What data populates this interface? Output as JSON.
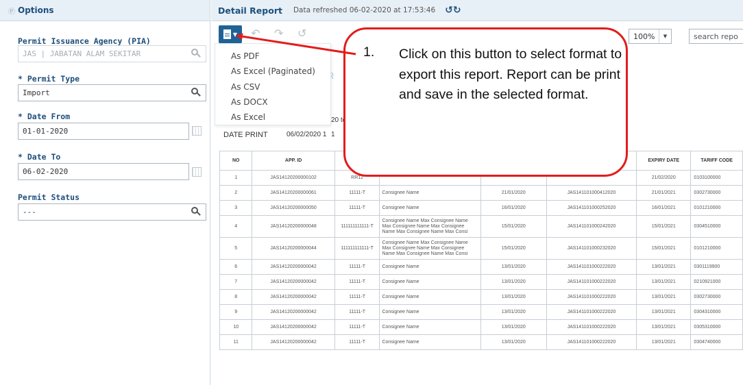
{
  "options_panel": {
    "title": "Options",
    "fields": [
      {
        "label": "Permit Issuance Agency (PIA)",
        "value": "JAS | JABATAN ALAM SEKITAR",
        "disabled": true
      },
      {
        "label": "* Permit Type",
        "value": "Import"
      },
      {
        "label": "* Date From",
        "value": "01-01-2020"
      },
      {
        "label": "* Date To",
        "value": "06-02-2020"
      },
      {
        "label": "Permit Status",
        "value": "---"
      }
    ]
  },
  "header": {
    "title": "Detail Report",
    "refresh_text": "Data refreshed 06-02-2020 at 17:53:46",
    "refresh_icon": "refresh-icon"
  },
  "toolbar": {
    "zoom": "100%",
    "search_placeholder": "search repo"
  },
  "export_menu": {
    "items": [
      "As PDF",
      "As Excel (Paginated)",
      "As CSV",
      "As DOCX",
      "As Excel"
    ]
  },
  "report": {
    "fragment_date": "20 to",
    "fragment_time": "1",
    "letter": "R",
    "date_print_label": "DATE PRINT",
    "date_print_value": "06/02/2020 1",
    "columns": [
      "NO",
      "APP. ID",
      "T",
      "",
      "",
      "",
      "EXPIRY DATE",
      "TARIFF CODE"
    ],
    "rows": [
      [
        "1",
        "JAS14120200000102",
        "RR12",
        "",
        "",
        "",
        "21/02/2020",
        "0103100000"
      ],
      [
        "2",
        "JAS14120200000061",
        "11111-T",
        "Consignee Name",
        "21/01/2020",
        "JAS141101000412020",
        "21/01/2021",
        "0302730000"
      ],
      [
        "3",
        "JAS14120200000050",
        "11111-T",
        "Consignee Name",
        "16/01/2020",
        "JAS141101000252020",
        "16/01/2021",
        "0101210000"
      ],
      [
        "4",
        "JAS14120200000048",
        "111111111111-T",
        "Consignee Name Max Consignee Name Max Consignee Name Max Consignee Name Max Consignee Name Max Consi",
        "15/01/2020",
        "JAS141101000242020",
        "15/01/2021",
        "0304510000"
      ],
      [
        "5",
        "JAS14120200000044",
        "111111111111-T",
        "Consignee Name Max Consignee Name Max Consignee Name Max Consignee Name Max Consignee Name Max Consi",
        "15/01/2020",
        "JAS141101000232020",
        "15/01/2021",
        "0101210000"
      ],
      [
        "6",
        "JAS14120200000042",
        "11111-T",
        "Consignee Name",
        "13/01/2020",
        "JAS141101000222020",
        "13/01/2021",
        "0301119900"
      ],
      [
        "7",
        "JAS14120200000042",
        "11111-T",
        "Consignee Name",
        "13/01/2020",
        "JAS141101000222020",
        "13/01/2021",
        "0210921000"
      ],
      [
        "8",
        "JAS14120200000042",
        "11111-T",
        "Consignee Name",
        "13/01/2020",
        "JAS141101000222020",
        "13/01/2021",
        "0302730000"
      ],
      [
        "9",
        "JAS14120200000042",
        "11111-T",
        "Consignee Name",
        "13/01/2020",
        "JAS141101000222020",
        "13/01/2021",
        "0304310000"
      ],
      [
        "10",
        "JAS14120200000042",
        "11111-T",
        "Consignee Name",
        "13/01/2020",
        "JAS141101000222020",
        "13/01/2021",
        "0305310000"
      ],
      [
        "11",
        "JAS14120200000042",
        "11111-T",
        "Consignee Name",
        "13/01/2020",
        "JAS141101000222020",
        "13/01/2021",
        "0304740000"
      ]
    ]
  },
  "callout": {
    "number": "1.",
    "text": "Click on this button to select format to export this report. Report can be print and save in the selected format.",
    "border_color": "#e31c1c"
  }
}
